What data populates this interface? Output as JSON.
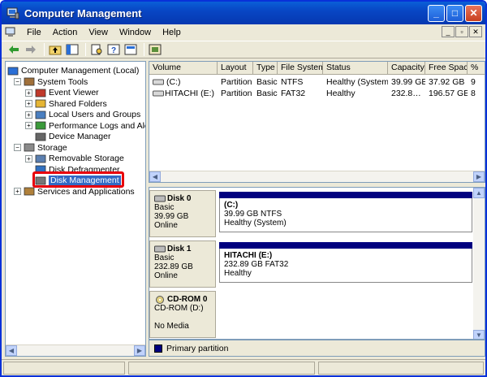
{
  "window": {
    "title": "Computer Management",
    "min": "_",
    "max": "□",
    "close": "✕"
  },
  "menu": {
    "items": [
      "File",
      "Action",
      "View",
      "Window",
      "Help"
    ],
    "mdi": [
      "_",
      "▫",
      "✕"
    ]
  },
  "toolbar": {
    "icons": [
      "back-icon",
      "forward-icon",
      "up-folder-icon",
      "show-tree-icon",
      "properties-icon",
      "help-icon",
      "show-hide-icon",
      "settings-icon"
    ]
  },
  "tree": [
    {
      "label": "Computer Management (Local)",
      "icon": "computer-icon",
      "exp": "",
      "indent": 0
    },
    {
      "label": "System Tools",
      "icon": "tools-icon",
      "exp": "−",
      "indent": 1
    },
    {
      "label": "Event Viewer",
      "icon": "event-viewer-icon",
      "exp": "+",
      "indent": 2
    },
    {
      "label": "Shared Folders",
      "icon": "shared-folder-icon",
      "exp": "+",
      "indent": 2
    },
    {
      "label": "Local Users and Groups",
      "icon": "users-icon",
      "exp": "+",
      "indent": 2
    },
    {
      "label": "Performance Logs and Alerts",
      "icon": "performance-icon",
      "exp": "+",
      "indent": 2
    },
    {
      "label": "Device Manager",
      "icon": "device-manager-icon",
      "exp": "",
      "indent": 2
    },
    {
      "label": "Storage",
      "icon": "storage-icon",
      "exp": "−",
      "indent": 1
    },
    {
      "label": "Removable Storage",
      "icon": "removable-storage-icon",
      "exp": "+",
      "indent": 2
    },
    {
      "label": "Disk Defragmenter",
      "icon": "defrag-icon",
      "exp": "",
      "indent": 2
    },
    {
      "label": "Disk Management",
      "icon": "disk-management-icon",
      "exp": "",
      "indent": 2,
      "selected": true
    },
    {
      "label": "Services and Applications",
      "icon": "services-icon",
      "exp": "+",
      "indent": 1
    }
  ],
  "list": {
    "columns": [
      "Volume",
      "Layout",
      "Type",
      "File System",
      "Status",
      "Capacity",
      "Free Space",
      "%"
    ],
    "rows": [
      [
        "(C:)",
        "Partition",
        "Basic",
        "NTFS",
        "Healthy (System)",
        "39.99 GB",
        "37.92 GB",
        "9"
      ],
      [
        "HITACHI (E:)",
        "Partition",
        "Basic",
        "FAT32",
        "Healthy",
        "232.8…",
        "196.57 GB",
        "8"
      ]
    ]
  },
  "disks": [
    {
      "name": "Disk 0",
      "type": "Basic",
      "size": "39.99 GB",
      "state": "Online",
      "part": {
        "name": "(C:)",
        "info": "39.99 GB NTFS",
        "status": "Healthy (System)"
      }
    },
    {
      "name": "Disk 1",
      "type": "Basic",
      "size": "232.89 GB",
      "state": "Online",
      "part": {
        "name": "HITACHI  (E:)",
        "info": "232.89 GB FAT32",
        "status": "Healthy"
      }
    },
    {
      "name": "CD-ROM 0",
      "type": "CD-ROM (D:)",
      "size": "",
      "state": "No Media"
    }
  ],
  "legend": {
    "label": "Primary partition",
    "color": "#00007f"
  },
  "colors": {
    "titlebar": "#0846c4",
    "selection": "#316ac5",
    "highlight": "#e8000b"
  }
}
